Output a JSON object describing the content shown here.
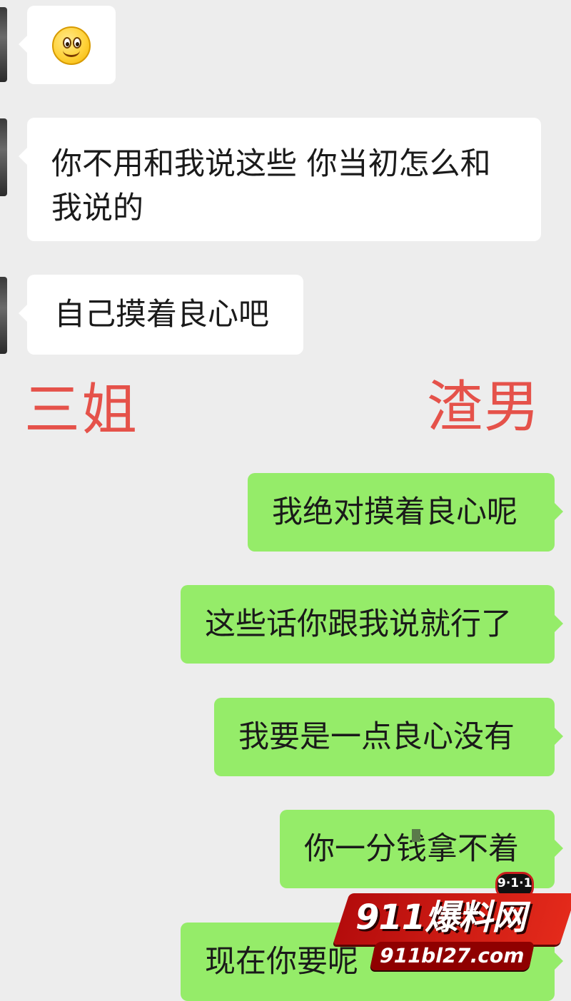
{
  "chat": {
    "left_messages": [
      {
        "emoji": "smile-emoji"
      },
      {
        "text": "你不用和我说这些 你当初怎么和\n我说的"
      },
      {
        "text": "自己摸着良心吧"
      }
    ],
    "right_messages": [
      {
        "text": "我绝对摸着良心呢"
      },
      {
        "text": "这些话你跟我说就行了"
      },
      {
        "text": "我要是一点良心没有"
      },
      {
        "text": "你一分钱拿不着"
      },
      {
        "text": "现在你要呢"
      }
    ]
  },
  "annotations": {
    "left_label": "三姐",
    "right_label": "渣男"
  },
  "watermark": {
    "badge": "9·1·1",
    "title": "911爆料网",
    "url": "911bl27.com"
  },
  "colors": {
    "background": "#ededed",
    "left_bubble": "#ffffff",
    "right_bubble": "#95ec69",
    "label_red": "#e5524a",
    "watermark_red": "#c81d1d"
  }
}
